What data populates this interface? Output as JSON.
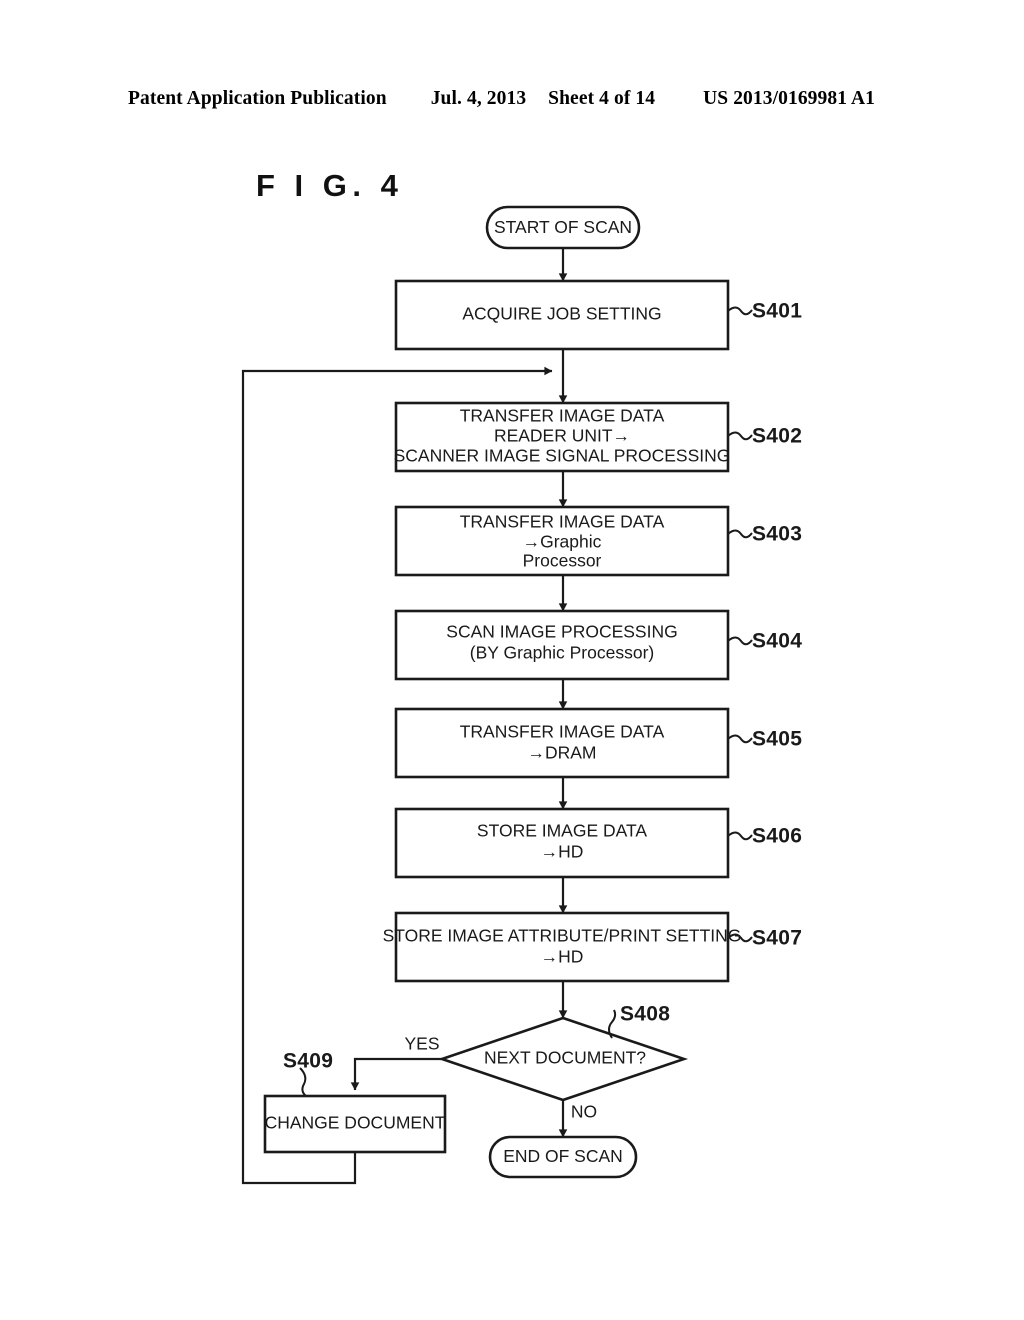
{
  "header": {
    "publication": "Patent Application Publication",
    "date": "Jul. 4, 2013",
    "sheet": "Sheet 4 of 14",
    "patent_number": "US 2013/0169981 A1"
  },
  "figure": {
    "caption": "F I G.  4"
  },
  "flowchart": {
    "start": {
      "label": "START OF SCAN"
    },
    "end": {
      "label": "END OF SCAN"
    },
    "steps": [
      {
        "id": "S401",
        "step_label": "S401",
        "lines": [
          "ACQUIRE JOB SETTING"
        ]
      },
      {
        "id": "S402",
        "step_label": "S402",
        "lines": [
          "TRANSFER IMAGE DATA",
          "READER UNIT→",
          "SCANNER IMAGE SIGNAL PROCESSING"
        ]
      },
      {
        "id": "S403",
        "step_label": "S403",
        "lines": [
          "TRANSFER IMAGE DATA",
          "→Graphic",
          "Processor"
        ]
      },
      {
        "id": "S404",
        "step_label": "S404",
        "lines": [
          "SCAN IMAGE PROCESSING",
          "(BY Graphic Processor)"
        ]
      },
      {
        "id": "S405",
        "step_label": "S405",
        "lines": [
          "TRANSFER IMAGE DATA",
          "→DRAM"
        ]
      },
      {
        "id": "S406",
        "step_label": "S406",
        "lines": [
          "STORE IMAGE DATA",
          "→HD"
        ]
      },
      {
        "id": "S407",
        "step_label": "S407",
        "lines": [
          "STORE IMAGE ATTRIBUTE/PRINT SETTING",
          "→HD"
        ]
      }
    ],
    "decision": {
      "id": "S408",
      "step_label": "S408",
      "label": "NEXT DOCUMENT?",
      "yes_label": "YES",
      "no_label": "NO"
    },
    "loop_step": {
      "id": "S409",
      "step_label": "S409",
      "label": "CHANGE DOCUMENT"
    }
  },
  "colors": {
    "ink": "#1a1a1a",
    "paper": "#ffffff"
  }
}
